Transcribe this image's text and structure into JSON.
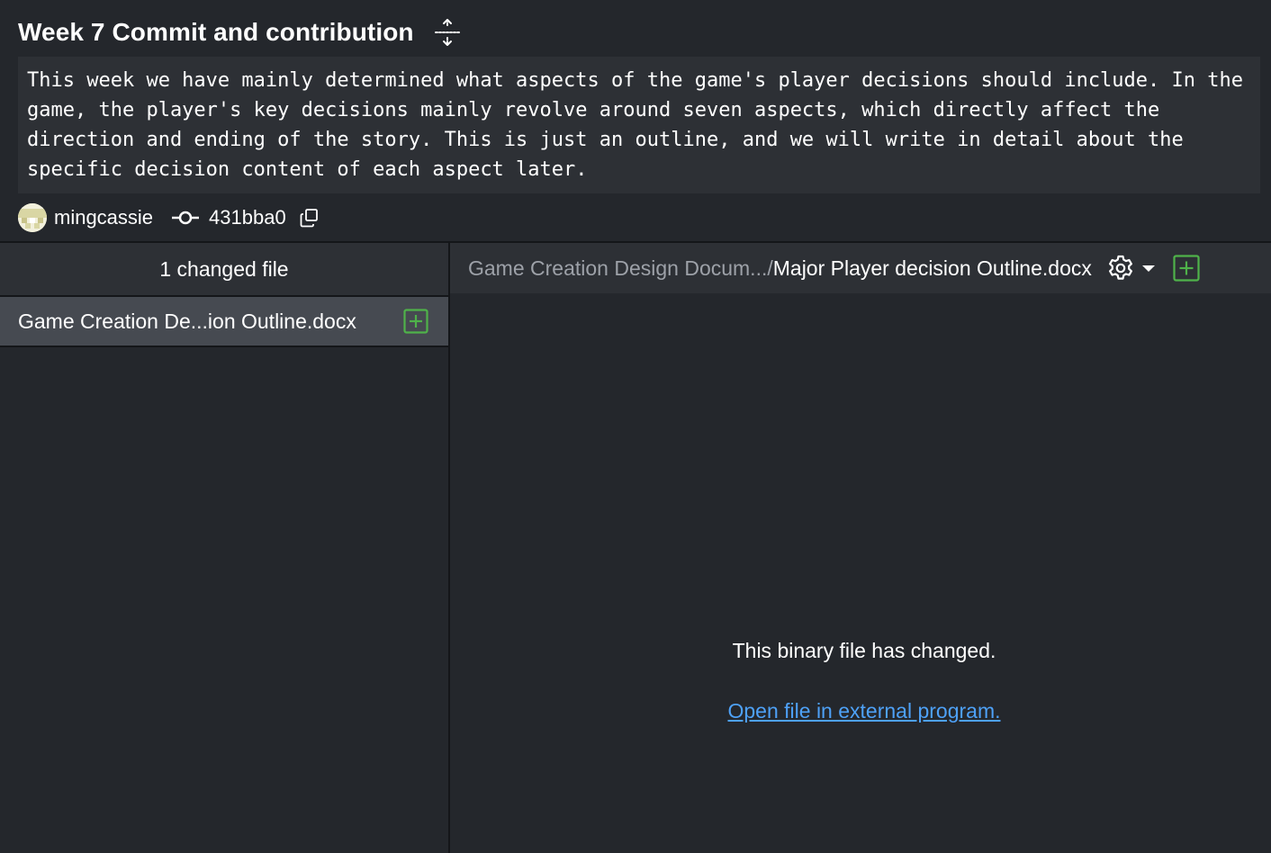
{
  "commit": {
    "title": "Week 7 Commit and contribution",
    "description": "This week we have mainly determined what aspects of the game's player decisions should include. In the game, the player's key decisions mainly revolve around seven aspects, which directly affect the direction and ending of the story. This is just an outline, and we will write in detail about the specific decision content of each aspect later.",
    "author": "mingcassie",
    "sha": "431bba0"
  },
  "sidebar": {
    "changed_files_label": "1 changed file",
    "files": [
      {
        "name": "Game Creation De...ion Outline.docx",
        "status": "added"
      }
    ]
  },
  "diff": {
    "path_dir": "Game Creation Design Docum.../",
    "path_file": "Major Player decision Outline.docx",
    "binary_message": "This binary file has changed.",
    "open_external_link": "Open file in external program."
  },
  "icons": {
    "expand": "expand-arrows-icon",
    "commit": "git-commit-icon",
    "copy": "copy-icon",
    "added": "file-added-icon",
    "settings": "gear-icon",
    "dropdown": "caret-down-icon"
  },
  "colors": {
    "background": "#24272c",
    "panel": "#2d3035",
    "selected_row": "#464a51",
    "added_green": "#4fb24a",
    "link_blue": "#4ea1f7",
    "muted_text": "#9da1a8"
  }
}
